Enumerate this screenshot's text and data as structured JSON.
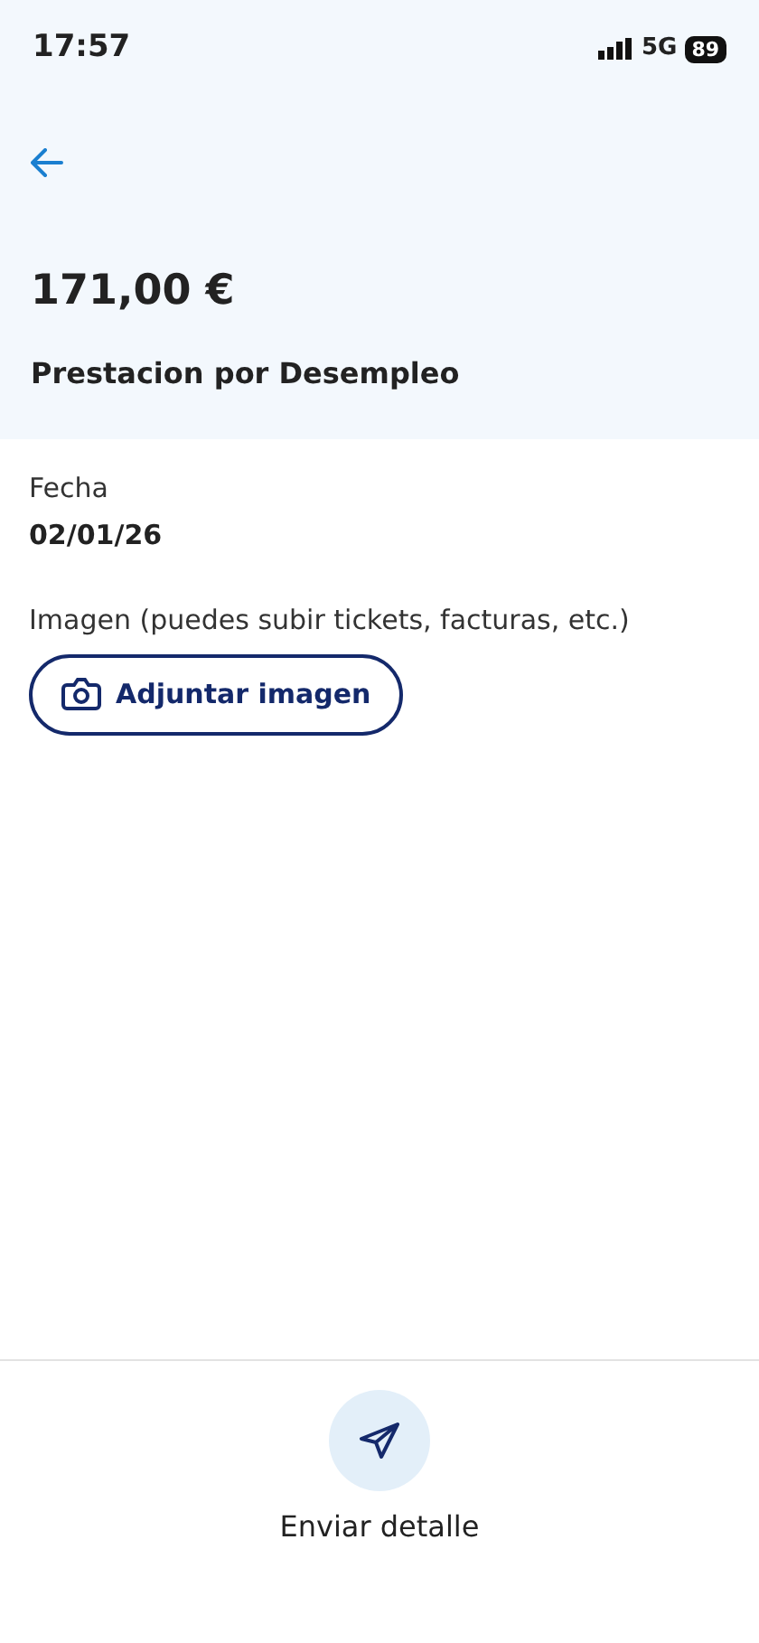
{
  "status_bar": {
    "time": "17:57",
    "network": "5G",
    "battery": "89"
  },
  "header": {
    "amount": "171,00 €",
    "title": "Prestacion por Desempleo"
  },
  "fields": [
    {
      "label": "Fecha",
      "value": "02/01/26"
    }
  ],
  "attachment": {
    "label": "Imagen (puedes subir tickets, facturas, etc.)",
    "button": "Adjuntar imagen"
  },
  "footer": {
    "action": "Enviar detalle"
  }
}
